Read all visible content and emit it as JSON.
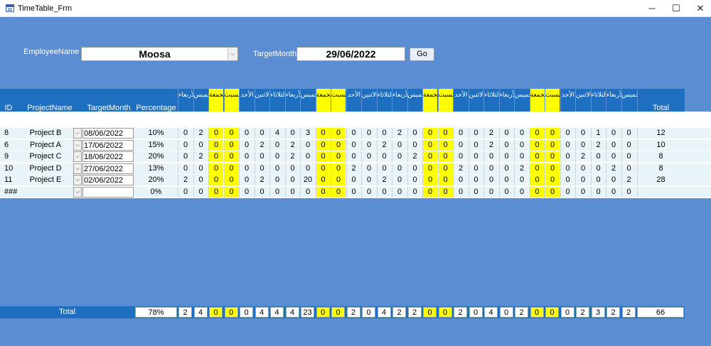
{
  "window": {
    "title": "TimeTable_Frm",
    "minimize_glyph": "─",
    "maximize_glyph": "☐",
    "close_glyph": "✕"
  },
  "filters": {
    "employee_label": "EmployeeName",
    "employee_value": "Moosa",
    "month_label": "TargetMonth",
    "month_value": "29/06/2022",
    "go_label": "Go",
    "dropdown_glyph": "⌵"
  },
  "header": {
    "id": "ID",
    "project": "ProjectName",
    "target_month": "TargetMonth",
    "percentage": "Percentage",
    "total": "Total",
    "days": [
      {
        "n": "1",
        "name": "الأربعاء",
        "we": false
      },
      {
        "n": "2",
        "name": "الخميس",
        "we": false
      },
      {
        "n": "3",
        "name": "الجمعة",
        "we": true
      },
      {
        "n": "4",
        "name": "السبت",
        "we": true
      },
      {
        "n": "5",
        "name": "الأحد",
        "we": false
      },
      {
        "n": "6",
        "name": "الاثنين",
        "we": false
      },
      {
        "n": "7",
        "name": "الثلاثاء",
        "we": false
      },
      {
        "n": "8",
        "name": "الأربعاء",
        "we": false
      },
      {
        "n": "9",
        "name": "الخميس",
        "we": false
      },
      {
        "n": "10",
        "name": "الجمعة",
        "we": true
      },
      {
        "n": "11",
        "name": "السبت",
        "we": true
      },
      {
        "n": "12",
        "name": "الأحد",
        "we": false
      },
      {
        "n": "13",
        "name": "الاثنين",
        "we": false
      },
      {
        "n": "14",
        "name": "الثلاثاء",
        "we": false
      },
      {
        "n": "15",
        "name": "الأربعاء",
        "we": false
      },
      {
        "n": "16",
        "name": "الخميس",
        "we": false
      },
      {
        "n": "17",
        "name": "الجمعة",
        "we": true
      },
      {
        "n": "18",
        "name": "السبت",
        "we": true
      },
      {
        "n": "19",
        "name": "الأحد",
        "we": false
      },
      {
        "n": "20",
        "name": "الاثنين",
        "we": false
      },
      {
        "n": "21",
        "name": "الثلاثاء",
        "we": false
      },
      {
        "n": "22",
        "name": "الأربعاء",
        "we": false
      },
      {
        "n": "23",
        "name": "الخميس",
        "we": false
      },
      {
        "n": "24",
        "name": "الجمعة",
        "we": true
      },
      {
        "n": "25",
        "name": "السبت",
        "we": true
      },
      {
        "n": "26",
        "name": "الأحد",
        "we": false
      },
      {
        "n": "27",
        "name": "الاثنين",
        "we": false
      },
      {
        "n": "28",
        "name": "الثلاثاء",
        "we": false
      },
      {
        "n": "29",
        "name": "الأربعاء",
        "we": false
      },
      {
        "n": "30",
        "name": "الخميس",
        "we": false
      }
    ]
  },
  "rows": [
    {
      "id": "8",
      "project": "Project B",
      "date": "08/06/2022",
      "pct": "10%",
      "days": [
        "0",
        "2",
        "0",
        "0",
        "0",
        "0",
        "4",
        "0",
        "3",
        "0",
        "0",
        "0",
        "0",
        "0",
        "2",
        "0",
        "0",
        "0",
        "0",
        "0",
        "2",
        "0",
        "0",
        "0",
        "0",
        "0",
        "0",
        "1",
        "0",
        "0"
      ],
      "total": "12"
    },
    {
      "id": "6",
      "project": "Project A",
      "date": "17/06/2022",
      "pct": "15%",
      "days": [
        "0",
        "0",
        "0",
        "0",
        "0",
        "2",
        "0",
        "2",
        "0",
        "0",
        "0",
        "0",
        "0",
        "2",
        "0",
        "0",
        "0",
        "0",
        "0",
        "0",
        "2",
        "0",
        "0",
        "0",
        "0",
        "0",
        "0",
        "2",
        "0",
        "0"
      ],
      "total": "10"
    },
    {
      "id": "9",
      "project": "Project C",
      "date": "18/06/2022",
      "pct": "20%",
      "days": [
        "0",
        "2",
        "0",
        "0",
        "0",
        "0",
        "0",
        "2",
        "0",
        "0",
        "0",
        "0",
        "0",
        "0",
        "0",
        "2",
        "0",
        "0",
        "0",
        "0",
        "0",
        "0",
        "0",
        "0",
        "0",
        "0",
        "2",
        "0",
        "0",
        "0"
      ],
      "total": "8"
    },
    {
      "id": "10",
      "project": "Project D",
      "date": "27/06/2022",
      "pct": "13%",
      "days": [
        "0",
        "0",
        "0",
        "0",
        "0",
        "0",
        "0",
        "0",
        "0",
        "0",
        "0",
        "2",
        "0",
        "0",
        "0",
        "0",
        "0",
        "0",
        "2",
        "0",
        "0",
        "0",
        "2",
        "0",
        "0",
        "0",
        "0",
        "0",
        "2",
        "0"
      ],
      "total": "8"
    },
    {
      "id": "11",
      "project": "Project E",
      "date": "02/06/2022",
      "pct": "20%",
      "days": [
        "2",
        "0",
        "0",
        "0",
        "0",
        "2",
        "0",
        "0",
        "20",
        "0",
        "0",
        "0",
        "0",
        "2",
        "0",
        "0",
        "0",
        "0",
        "0",
        "0",
        "0",
        "0",
        "0",
        "0",
        "0",
        "0",
        "0",
        "0",
        "0",
        "2"
      ],
      "total": "28"
    },
    {
      "id": "###",
      "project": "",
      "date": "",
      "pct": "0%",
      "days": [
        "0",
        "0",
        "0",
        "0",
        "0",
        "0",
        "0",
        "0",
        "0",
        "0",
        "0",
        "0",
        "0",
        "0",
        "0",
        "0",
        "0",
        "0",
        "0",
        "0",
        "0",
        "0",
        "0",
        "0",
        "0",
        "0",
        "0",
        "0",
        "0",
        "0"
      ],
      "total": ""
    }
  ],
  "totals": {
    "label": "Total",
    "pct": "78%",
    "days": [
      "2",
      "4",
      "0",
      "0",
      "0",
      "4",
      "4",
      "4",
      "23",
      "0",
      "0",
      "2",
      "0",
      "4",
      "2",
      "2",
      "0",
      "0",
      "2",
      "0",
      "4",
      "0",
      "2",
      "0",
      "0",
      "0",
      "2",
      "3",
      "2",
      "2"
    ],
    "total": "66"
  }
}
